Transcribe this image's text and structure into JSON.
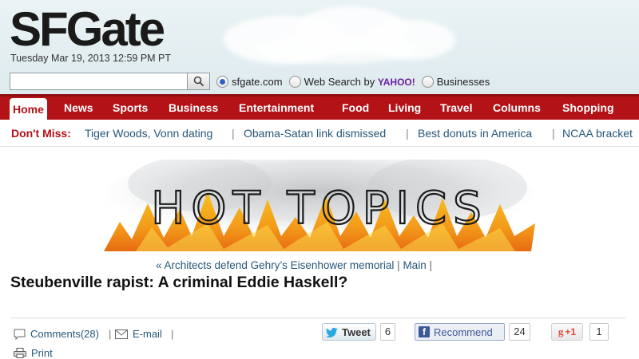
{
  "header": {
    "logo": "SFGate",
    "dateline": "Tuesday Mar 19, 2013 12:59 PM PT"
  },
  "search": {
    "value": "",
    "options": [
      {
        "label": "sfgate.com",
        "checked": true
      },
      {
        "label": "Web Search by",
        "brand": "YAHOO!",
        "checked": false
      },
      {
        "label": "Businesses",
        "checked": false
      }
    ]
  },
  "nav": {
    "items": [
      "Home",
      "News",
      "Sports",
      "Business",
      "Entertainment",
      "Food",
      "Living",
      "Travel",
      "Columns",
      "Shopping"
    ],
    "active": "Home"
  },
  "dont_miss": {
    "label": "Don't Miss:",
    "links": [
      "Tiger Woods, Vonn dating",
      "Obama-Satan link dismissed",
      "Best donuts in America",
      "NCAA bracket"
    ]
  },
  "banner": {
    "text": "HOT TOPICS"
  },
  "subnav": {
    "prev_link": "« Architects defend Gehry’s Eisenhower memorial",
    "main_link": "Main"
  },
  "article": {
    "headline": "Steubenville rapist: A criminal Eddie Haskell?"
  },
  "tools": {
    "comments_label": "Comments(28)",
    "email_label": "E-mail",
    "print_label": "Print"
  },
  "social": {
    "tweet_label": "Tweet",
    "tweet_count": "6",
    "fb_label": "Recommend",
    "fb_count": "24",
    "gplus_label": "+1",
    "gplus_count": "1"
  },
  "colors": {
    "brand_red": "#b31217",
    "link_blue": "#26577a",
    "flame_orange": "#f5a11c"
  }
}
